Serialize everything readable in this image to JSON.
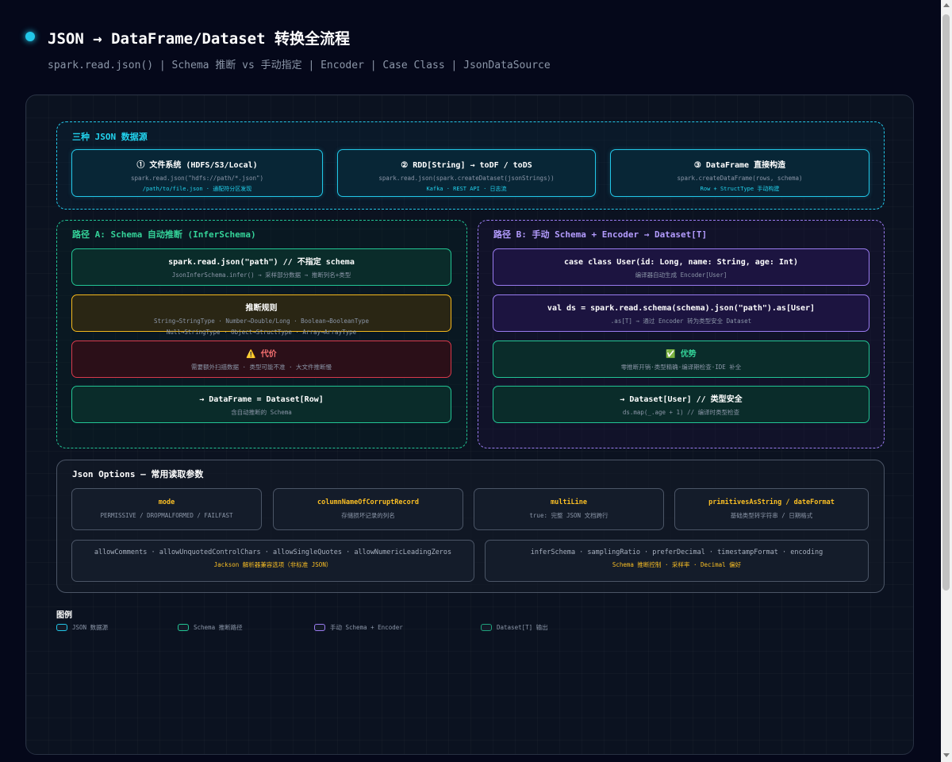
{
  "header": {
    "title": "JSON → DataFrame/Dataset 转换全流程",
    "subtitle": "spark.read.json() | Schema 推断 vs 手动指定 | Encoder | Case Class | JsonDataSource"
  },
  "sources": {
    "title": "三种 JSON 数据源",
    "items": [
      {
        "title": "① 文件系统 (HDFS/S3/Local)",
        "code": "spark.read.json(\"hdfs://path/*.json\")",
        "hint": "/path/to/file.json · 通配符分区发现"
      },
      {
        "title": "② RDD[String] → toDF / toDS",
        "code": "spark.read.json(spark.createDataset(jsonStrings))",
        "hint": "Kafka · REST API · 日志流"
      },
      {
        "title": "③ DataFrame 直接构造",
        "code": "spark.createDataFrame(rows, schema)",
        "hint": "Row + StructType 手动构建"
      }
    ]
  },
  "path_a": {
    "title": "路径 A: Schema 自动推断 (InferSchema)",
    "nodes": [
      {
        "title": "spark.read.json(\"path\") // 不指定 schema",
        "desc": "JsonInferSchema.infer() → 采样部分数据 → 推断列名+类型"
      },
      {
        "title": "推断规则",
        "desc": "String→StringType · Number→Double/Long · Boolean→BooleanType",
        "desc2": "Null→StringType · Object→StructType · Array→ArrayType"
      },
      {
        "title": "⚠️ 代价",
        "desc": "需要额外扫描数据 · 类型可能不准 · 大文件推断慢"
      },
      {
        "title": "→ DataFrame = Dataset[Row]",
        "desc": "含自动推断的 Schema"
      }
    ]
  },
  "path_b": {
    "title": "路径 B: 手动 Schema + Encoder → Dataset[T]",
    "nodes": [
      {
        "title": "case class User(id: Long, name: String, age: Int)",
        "desc": "编译器自动生成 Encoder[User]"
      },
      {
        "title": "val ds = spark.read.schema(schema).json(\"path\").as[User]",
        "desc": ".as[T] → 通过 Encoder 转为类型安全 Dataset"
      },
      {
        "title": "✅ 优势",
        "desc": "零推断开销·类型精确·编译期检查·IDE 补全"
      },
      {
        "title": "→ Dataset[User] // 类型安全",
        "desc": "ds.map(_.age + 1) // 编译时类型检查"
      }
    ]
  },
  "options": {
    "title": "Json Options — 常用读取参数",
    "items": [
      {
        "name": "mode",
        "desc": "PERMISSIVE / DROPMALFORMED / FAILFAST"
      },
      {
        "name": "columnNameOfCorruptRecord",
        "desc": "存储损坏记录的列名"
      },
      {
        "name": "multiLine",
        "desc": "true: 完整 JSON 文档跨行"
      },
      {
        "name": "primitivesAsString / dateFormat",
        "desc": "基础类型转字符串 / 日期格式"
      }
    ],
    "wide": [
      {
        "list": "allowComments · allowUnquotedControlChars · allowSingleQuotes · allowNumericLeadingZeros",
        "note": "Jackson 解析器兼容选项（非标准 JSON）"
      },
      {
        "list": "inferSchema · samplingRatio · preferDecimal · timestampFormat · encoding",
        "note": "Schema 推断控制 · 采样率 · Decimal 偏好"
      }
    ]
  },
  "legend": {
    "title": "图例",
    "items": [
      {
        "label": "JSON 数据源",
        "color": "#22c7e8"
      },
      {
        "label": "Schema 推断路径",
        "color": "#22c594"
      },
      {
        "label": "手动 Schema + Encoder",
        "color": "#9a7cf0"
      },
      {
        "label": "Dataset[T] 输出",
        "color": "#1fa27d"
      }
    ]
  }
}
